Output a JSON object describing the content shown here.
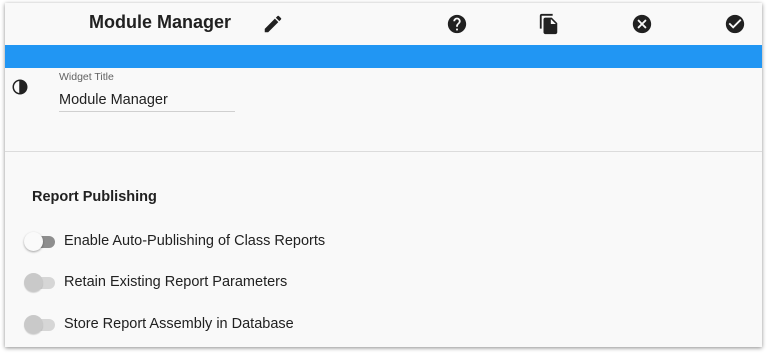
{
  "header": {
    "title": "Module Manager",
    "icons": {
      "edit": "pencil-icon",
      "help": "help-circle-icon",
      "copy": "copy-icon",
      "close": "close-circle-icon",
      "save": "check-circle-icon"
    }
  },
  "colors": {
    "accent_bar": "#2196f3",
    "background": "#f9f9f9"
  },
  "widget": {
    "theme_icon": "contrast-icon",
    "title_label": "Widget Title",
    "title_value": "Module Manager"
  },
  "report_publishing": {
    "heading": "Report Publishing",
    "toggles": [
      {
        "label": "Enable Auto-Publishing of Class Reports",
        "checked": false,
        "enabled": true
      },
      {
        "label": "Retain Existing Report Parameters",
        "checked": false,
        "enabled": false
      },
      {
        "label": "Store Report Assembly in Database",
        "checked": false,
        "enabled": false
      }
    ]
  }
}
